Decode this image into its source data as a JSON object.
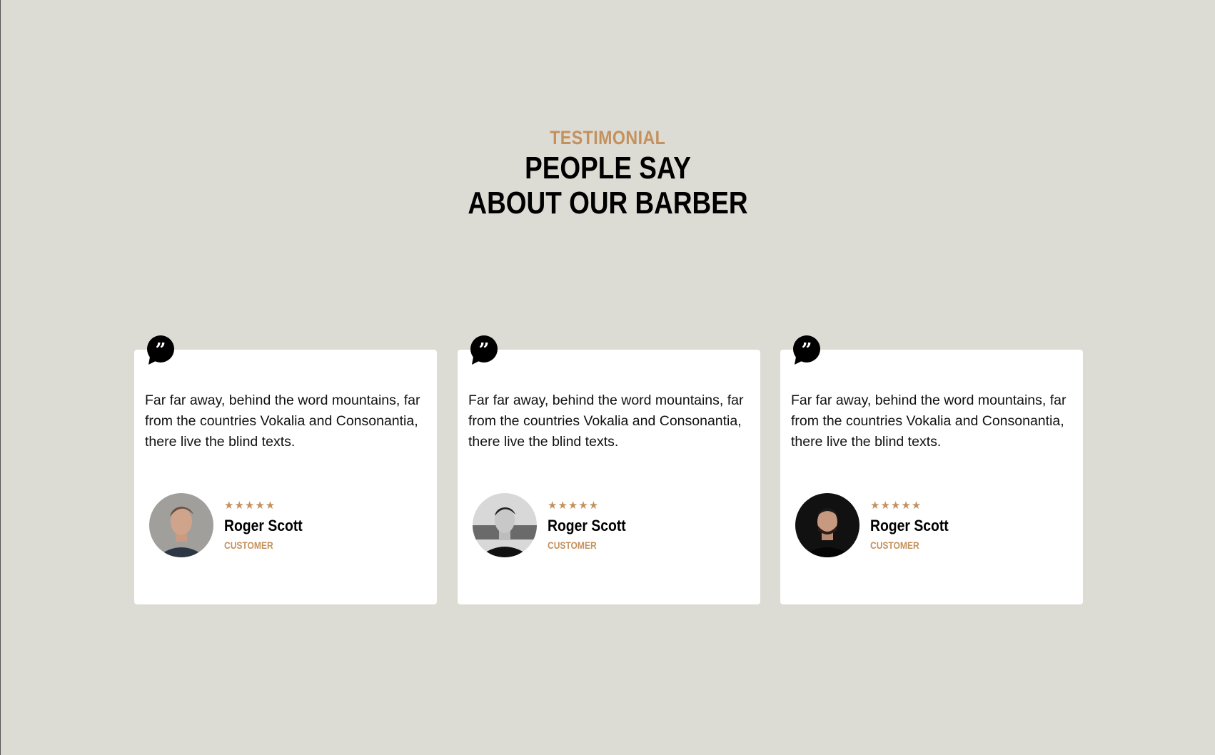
{
  "header": {
    "subtitle": "TESTIMONIAL",
    "title_line1": "PEOPLE SAY",
    "title_line2": "ABOUT OUR BARBER"
  },
  "colors": {
    "accent": "#c4915d",
    "background": "#dcdbd4"
  },
  "testimonials": [
    {
      "text": "Far far away, behind the word mountains, far from the countries Vokalia and Consonantia, there live the blind texts.",
      "stars": "★★★★★",
      "rating": 5,
      "name": "Roger Scott",
      "role": "CUSTOMER"
    },
    {
      "text": "Far far away, behind the word mountains, far from the countries Vokalia and Consonantia, there live the blind texts.",
      "stars": "★★★★★",
      "rating": 5,
      "name": "Roger Scott",
      "role": "CUSTOMER"
    },
    {
      "text": "Far far away, behind the word mountains, far from the countries Vokalia and Consonantia, there live the blind texts.",
      "stars": "★★★★★",
      "rating": 5,
      "name": "Roger Scott",
      "role": "CUSTOMER"
    }
  ]
}
